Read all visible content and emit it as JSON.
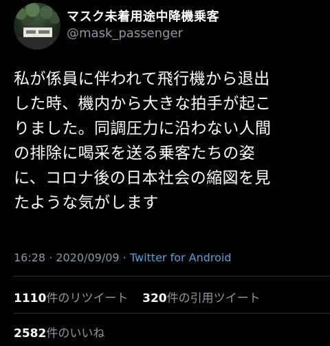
{
  "user": {
    "display_name": "マスク未着用途中降機乗客",
    "handle": "@mask_passenger",
    "avatar_icon": "profile-photo-plaque-icon"
  },
  "tweet": {
    "lines": [
      "私が係員に伴われて飛行機から退出",
      "した時、機内から大きな拍手が起こ",
      "りました。同調圧力に沿わない人間",
      "の排除に喝采を送る乗客たちの姿",
      "に、コロナ後の日本社会の縮図を見",
      "たような気がします"
    ],
    "time": "16:28",
    "separator": " · ",
    "date": "2020/09/09",
    "dot": " · ",
    "source": "Twitter for Android"
  },
  "stats": {
    "retweets_count": "1110",
    "retweets_label": "件のリツイート",
    "quotes_count": "320",
    "quotes_label": "件の引用ツイート",
    "likes_count": "2582",
    "likes_label": "件のいいね"
  },
  "colors": {
    "background": "#000000",
    "text": "#ffffff",
    "secondary": "#8b98a5",
    "link": "#4aa3df",
    "divider": "#2f3336"
  }
}
